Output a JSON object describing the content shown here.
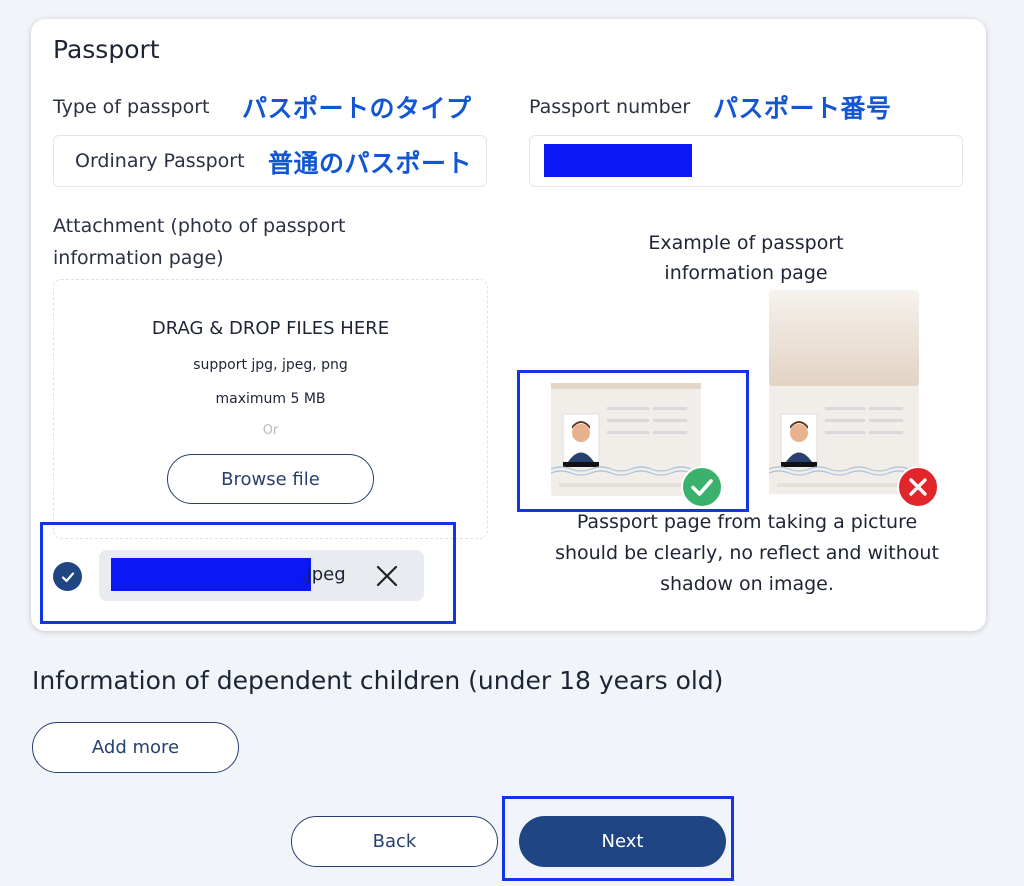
{
  "passport": {
    "section_title": "Passport",
    "type_label": "Type of passport",
    "type_label_jp": "パスポートのタイプ",
    "type_value": "Ordinary Passport",
    "type_value_jp": "普通のパスポート",
    "number_label": "Passport number",
    "number_label_jp": "パスポート番号",
    "attachment_label_line1": "Attachment (photo of passport",
    "attachment_label_line2": "information page)",
    "dropzone": {
      "title": "DRAG & DROP FILES HERE",
      "support": "support jpg, jpeg, png",
      "max": "maximum 5 MB",
      "or": "Or",
      "browse_label": "Browse file"
    },
    "uploaded_file": {
      "name_suffix": ".jpeg"
    },
    "example": {
      "title_line1": "Example of passport",
      "title_line2": "information page",
      "note_line1": "Passport page from taking a picture",
      "note_line2": "should be clearly, no reflect and without",
      "note_line3": "shadow on image."
    }
  },
  "children": {
    "title": "Information of dependent children (under 18 years old)",
    "add_more_label": "Add more"
  },
  "nav": {
    "back_label": "Back",
    "next_label": "Next"
  },
  "colors": {
    "primary": "#1f4583",
    "annotation_blue": "#1356d3",
    "highlight_box": "#1236e6",
    "success": "#3bb26c",
    "error": "#e0262b"
  }
}
